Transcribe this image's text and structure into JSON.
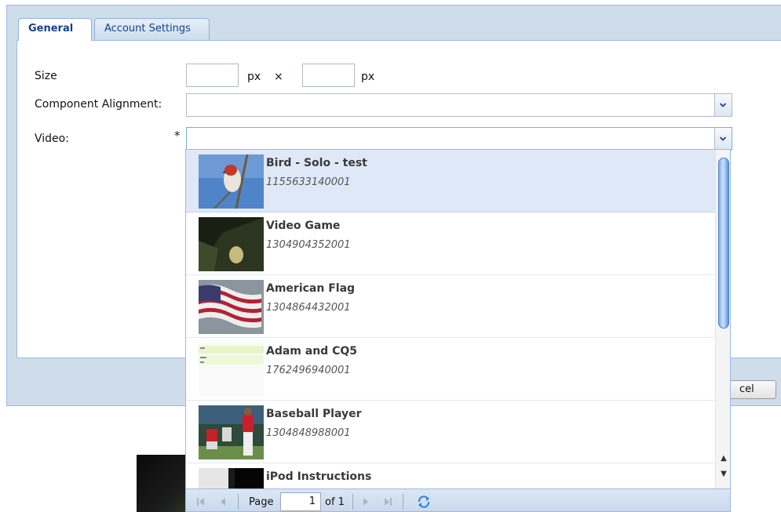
{
  "tabs": [
    {
      "label": "General",
      "active": true
    },
    {
      "label": "Account Settings",
      "active": false
    }
  ],
  "form": {
    "size_label": "Size",
    "size_unit_1": "px",
    "size_times": "×",
    "size_unit_2": "px",
    "alignment_label": "Component Alignment:",
    "video_label": "Video:",
    "required_mark": "*"
  },
  "footer": {
    "cancel_label_partial": "cel"
  },
  "videos": [
    {
      "title": "Bird - Solo - test",
      "id": "1155633140001",
      "selected": true
    },
    {
      "title": "Video Game",
      "id": "1304904352001"
    },
    {
      "title": "American Flag",
      "id": "1304864432001"
    },
    {
      "title": "Adam and CQ5",
      "id": "1762496940001"
    },
    {
      "title": "Baseball Player",
      "id": "1304848988001"
    },
    {
      "title": "iPod Instructions",
      "id": ""
    }
  ],
  "pager": {
    "page_label": "Page",
    "page_value": "1",
    "of_label": "of 1"
  },
  "colors": {
    "accent": "#15428b",
    "selected_row": "#dfe8f6",
    "frame": "#cfdcea"
  }
}
